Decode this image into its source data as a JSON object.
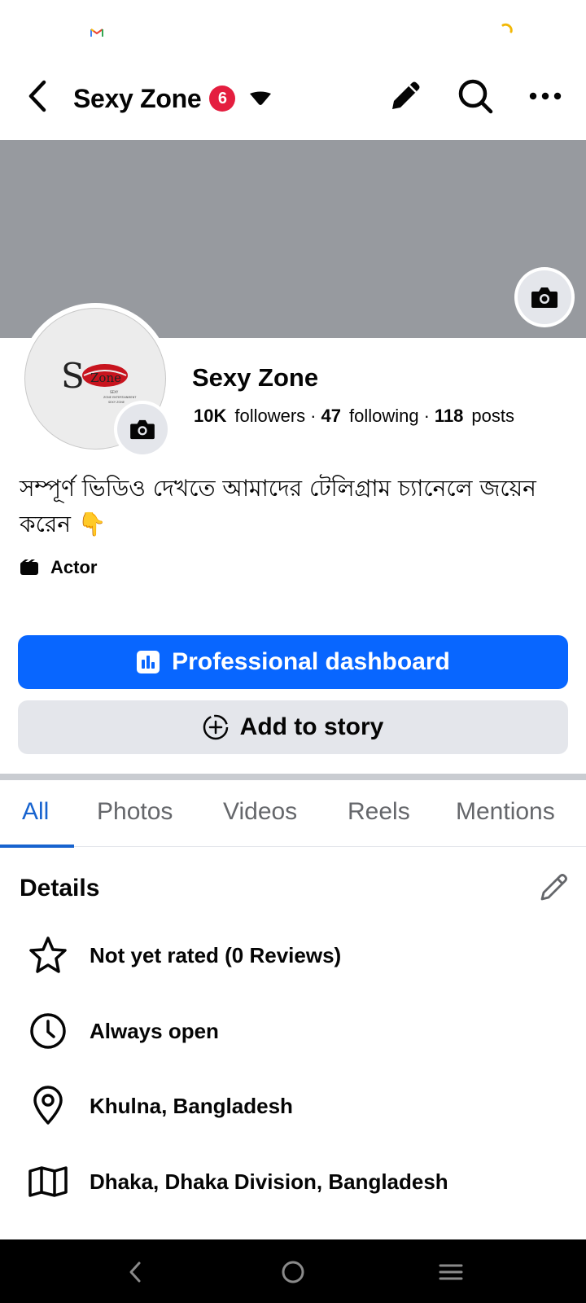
{
  "status_bar": {
    "notification_icon": "gmail-icon",
    "loading_icon": "loading-spinner-icon"
  },
  "header": {
    "title": "Sexy Zone",
    "badge_count": "6",
    "icons": [
      "back-arrow-icon",
      "caret-down-icon",
      "pencil-icon",
      "search-icon",
      "more-dots-icon"
    ]
  },
  "profile": {
    "name": "Sexy Zone",
    "followers_count": "10K",
    "followers_label": "followers",
    "following_count": "47",
    "following_label": "following",
    "posts_count": "118",
    "posts_label": "posts",
    "separator": "·",
    "bio": "সম্পূর্ণ ভিডিও দেখতে আমাদের টেলিগ্রাম চ্যানেলে জয়েন করেন 👇",
    "category": "Actor",
    "avatar_text": {
      "letter": "S",
      "word": "Zone",
      "caption_1": "SEXY",
      "caption_2": "ZONE ENTERTAINMENT",
      "caption_3": "SEXY ZONE"
    }
  },
  "actions": {
    "primary_label": "Professional dashboard",
    "secondary_label": "Add to story"
  },
  "tabs": [
    {
      "label": "All",
      "active": true
    },
    {
      "label": "Photos",
      "active": false
    },
    {
      "label": "Videos",
      "active": false
    },
    {
      "label": "Reels",
      "active": false
    },
    {
      "label": "Mentions",
      "active": false
    }
  ],
  "details": {
    "title": "Details",
    "items": [
      {
        "icon": "star-icon",
        "text": "Not yet rated (0 Reviews)"
      },
      {
        "icon": "clock-icon",
        "text": "Always open"
      },
      {
        "icon": "location-pin-icon",
        "text": "Khulna, Bangladesh"
      },
      {
        "icon": "map-icon",
        "text": "Dhaka, Dhaka Division, Bangladesh"
      }
    ]
  },
  "nav_bar": {
    "icons": [
      "nav-back-icon",
      "nav-home-icon",
      "nav-recents-icon"
    ]
  },
  "colors": {
    "primary_blue": "#0866ff",
    "tab_active": "#1763cf",
    "badge_red": "#e41e3f",
    "cover_gray": "#979a9f",
    "secondary_button": "#e4e6eb"
  }
}
